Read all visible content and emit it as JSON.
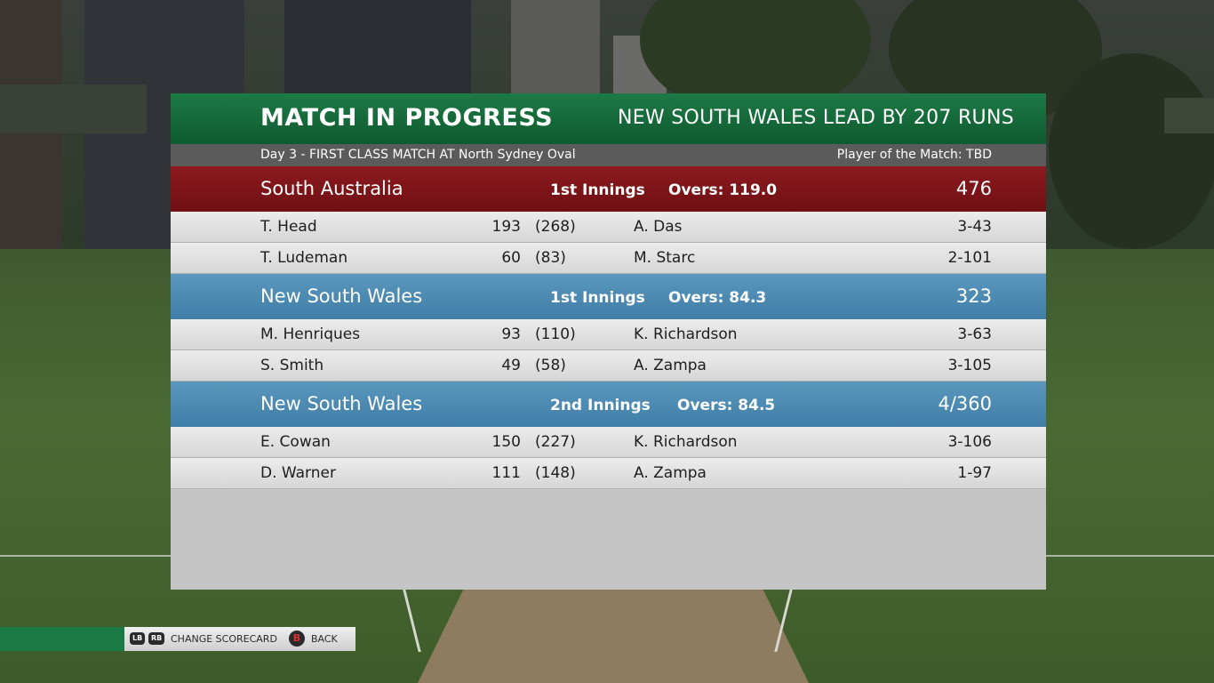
{
  "header": {
    "title": "MATCH IN PROGRESS",
    "lead": "NEW SOUTH WALES LEAD BY 207 RUNS"
  },
  "subbar": {
    "match_info": "Day 3 - FIRST CLASS MATCH AT North Sydney Oval",
    "player_of_match": "Player of the Match: TBD"
  },
  "innings": [
    {
      "team": "South Australia",
      "label": "1st Innings",
      "overs": "Overs: 119.0",
      "score": "476",
      "color": "#7e1519",
      "rows": [
        {
          "batter": "T. Head",
          "runs": "193",
          "balls": "(268)",
          "bowler": "A. Das",
          "figures": "3-43"
        },
        {
          "batter": "T. Ludeman",
          "runs": "60",
          "balls": "(83)",
          "bowler": "M. Starc",
          "figures": "2-101"
        }
      ]
    },
    {
      "team": "New South Wales",
      "label": "1st Innings",
      "overs": "Overs: 84.3",
      "score": "323",
      "color": "#4b8ab3",
      "rows": [
        {
          "batter": "M. Henriques",
          "runs": "93",
          "balls": "(110)",
          "bowler": "K. Richardson",
          "figures": "3-63"
        },
        {
          "batter": "S. Smith",
          "runs": "49",
          "balls": "(58)",
          "bowler": "A. Zampa",
          "figures": "3-105"
        }
      ]
    },
    {
      "team": "New South Wales",
      "label": "2nd Innings",
      "overs": "Overs: 84.5",
      "score": "4/360",
      "color": "#4b8ab3",
      "rows": [
        {
          "batter": "E. Cowan",
          "runs": "150",
          "balls": "(227)",
          "bowler": "K. Richardson",
          "figures": "3-106"
        },
        {
          "batter": "D. Warner",
          "runs": "111",
          "balls": "(148)",
          "bowler": "A. Zampa",
          "figures": "1-97"
        }
      ]
    }
  ],
  "footer": {
    "lb": "LB",
    "rb": "RB",
    "change_label": "CHANGE SCORECARD",
    "b": "B",
    "back_label": "BACK"
  }
}
